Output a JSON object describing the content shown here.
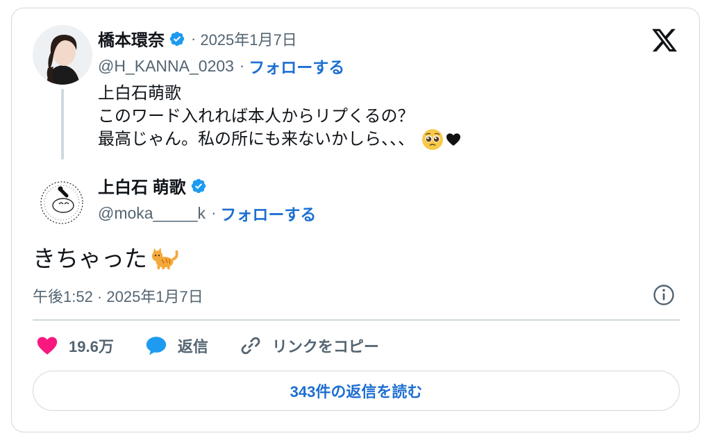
{
  "parent": {
    "display_name": "橋本環奈",
    "date": "2025年1月7日",
    "handle": "@H_KANNA_0203",
    "follow_label": "フォローする",
    "text_lines": [
      "上白石萌歌",
      "このワード入れれば本人からリプくるの？",
      "最高じゃん。私の所にも来ないかしら、、、"
    ],
    "emoji": [
      "pleading-face-icon",
      "black-heart-icon"
    ]
  },
  "tweet": {
    "display_name": "上白石 萌歌",
    "handle": "@moka_____k",
    "follow_label": "フォローする",
    "text": "きちゃった",
    "emoji": "cat-icon",
    "timestamp": "午後1:52 · 2025年1月7日"
  },
  "actions": {
    "likes": "19.6万",
    "reply_label": "返信",
    "copy_link_label": "リンクをコピー"
  },
  "read_replies_label": "343件の返信を読む",
  "separator": "·",
  "colors": {
    "accent": "#1d6fd1",
    "verified": "#1d9bf0",
    "like": "#f91880",
    "secondary_text": "#536471",
    "border": "#cfd9de"
  }
}
